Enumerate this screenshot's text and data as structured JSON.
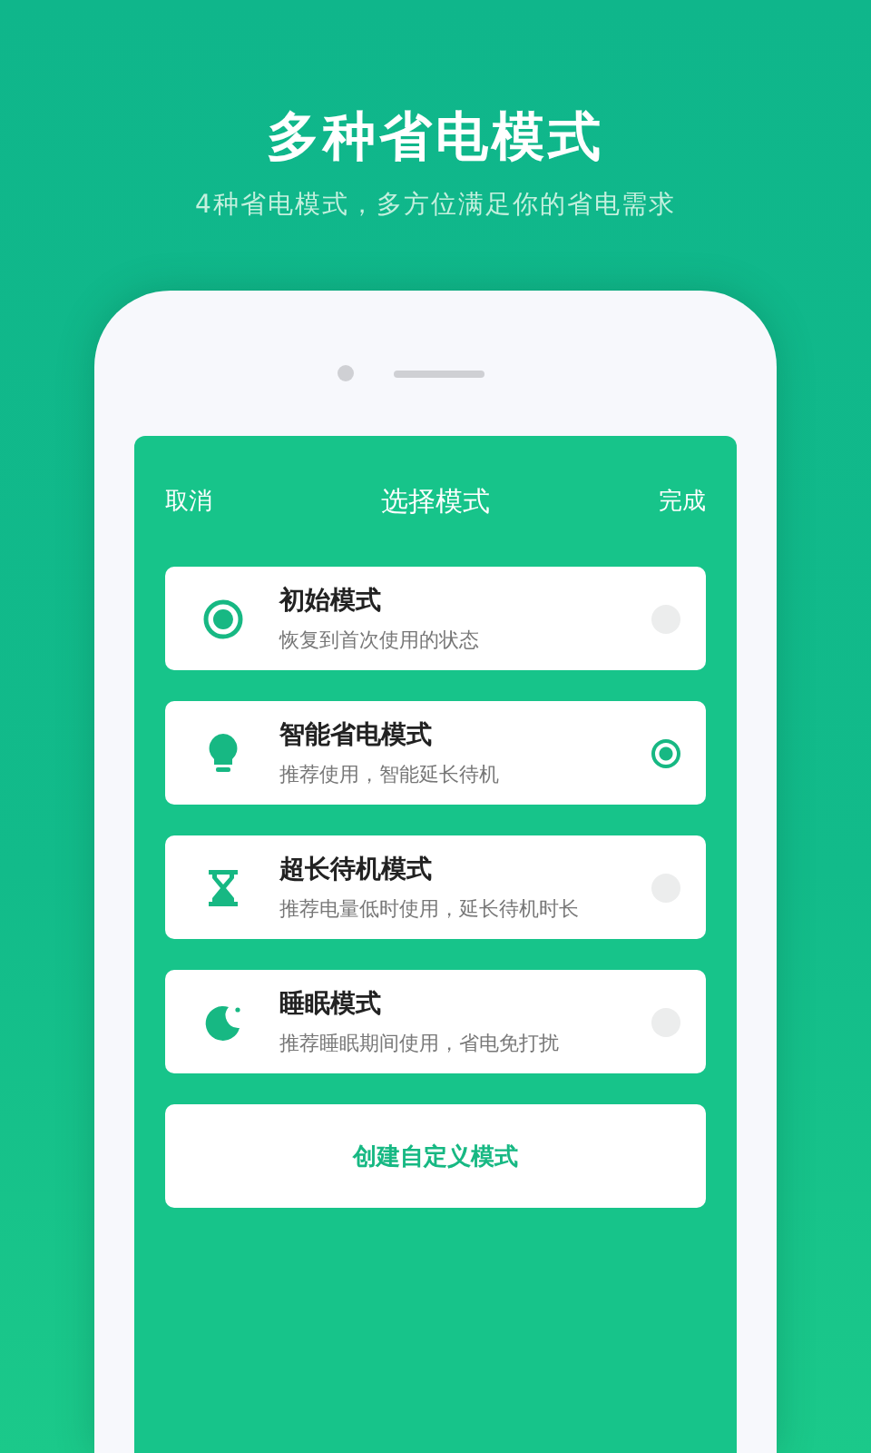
{
  "headline": "多种省电模式",
  "subtitle": "4种省电模式，多方位满足你的省电需求",
  "screen": {
    "cancel": "取消",
    "title": "选择模式",
    "done": "完成",
    "modes": [
      {
        "kind": "target",
        "name": "初始模式",
        "description": "恢复到首次使用的状态",
        "selected": false
      },
      {
        "kind": "bulb",
        "name": "智能省电模式",
        "description": "推荐使用，智能延长待机",
        "selected": true
      },
      {
        "kind": "hourglass",
        "name": "超长待机模式",
        "description": "推荐电量低时使用，延长待机时长",
        "selected": false
      },
      {
        "kind": "moon",
        "name": "睡眠模式",
        "description": "推荐睡眠期间使用，省电免打扰",
        "selected": false
      }
    ],
    "create_button": "创建自定义模式"
  }
}
